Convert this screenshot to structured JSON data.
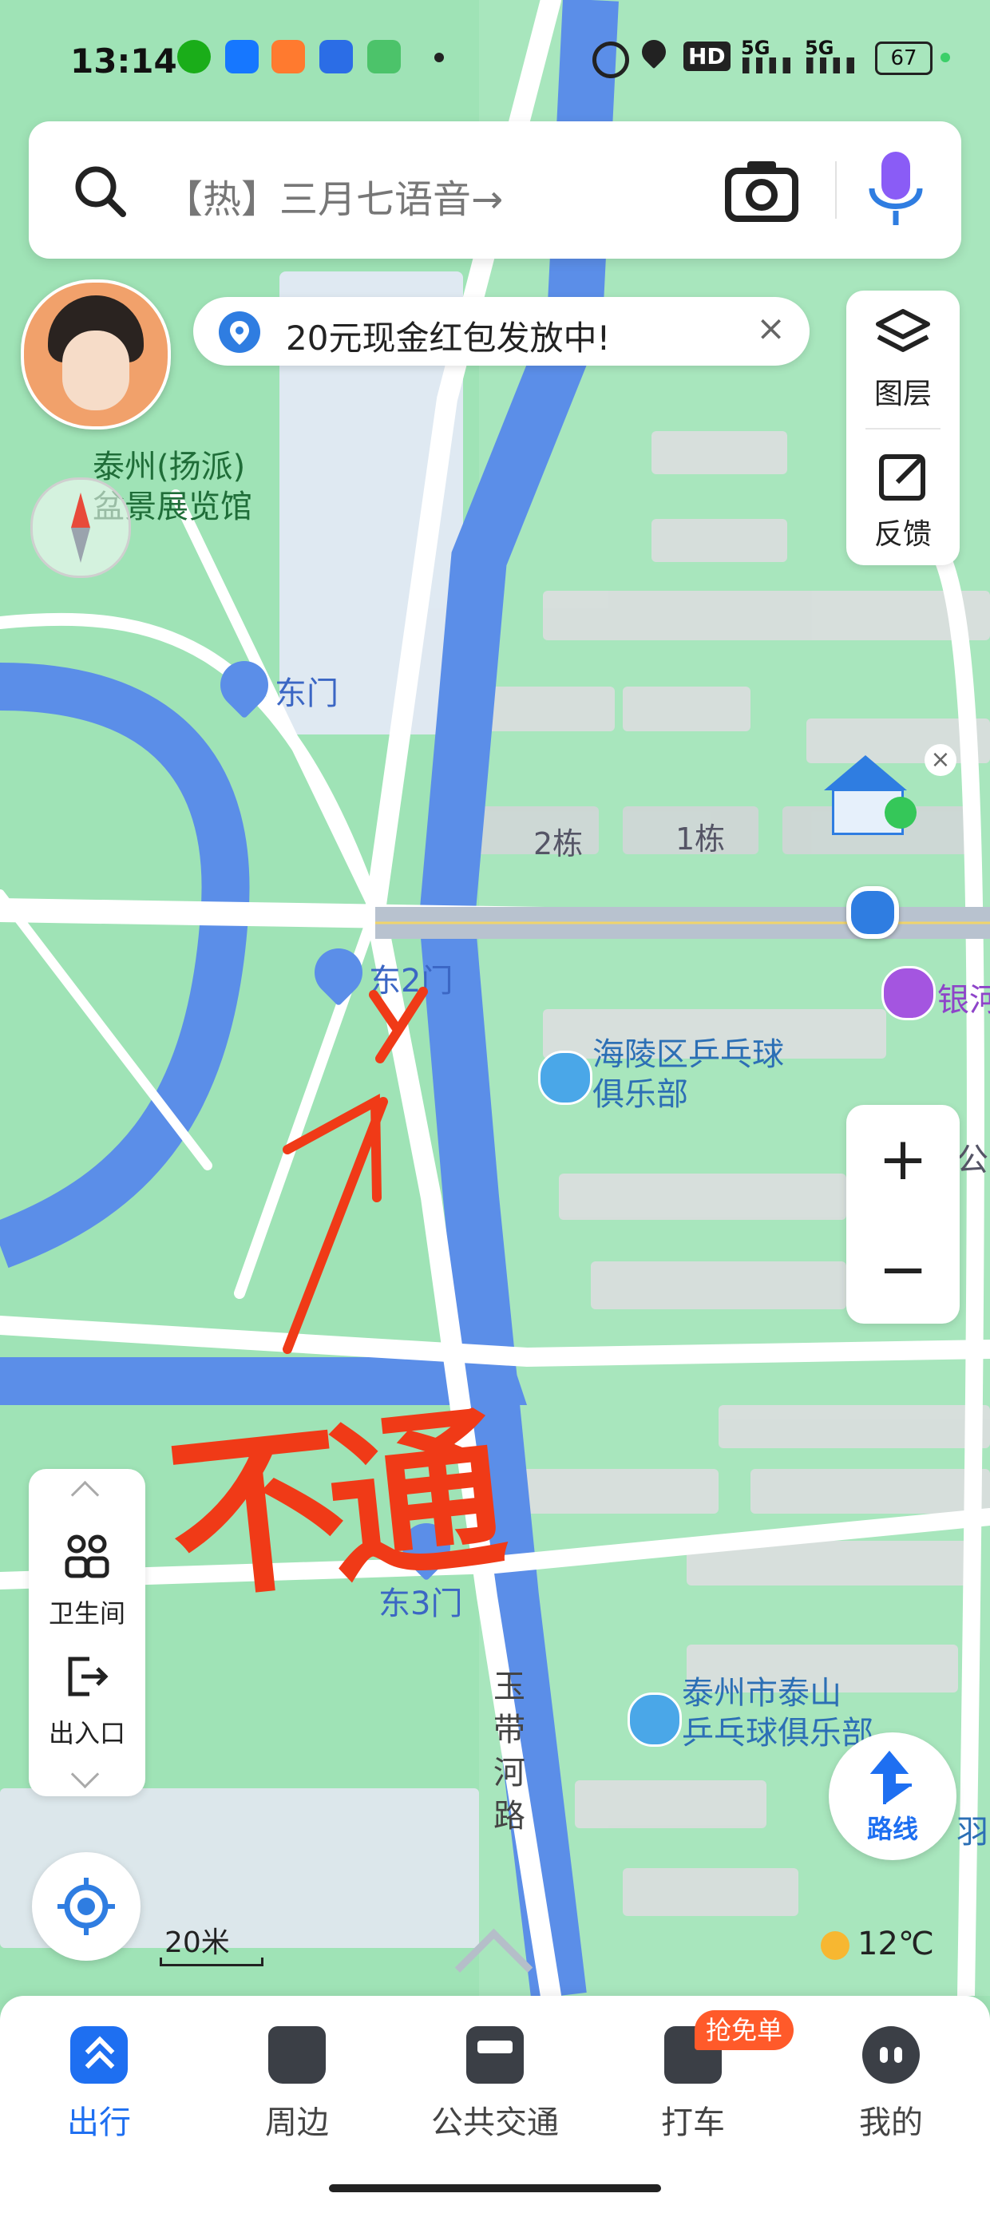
{
  "status_bar": {
    "time": "13:14",
    "network_5g_1": "5G",
    "network_5g_2": "5G",
    "hd": "HD",
    "battery": "67"
  },
  "search": {
    "placeholder": "【热】三月七语音→"
  },
  "promo": {
    "text": "20元现金红包发放中!",
    "close": "×"
  },
  "side_panel": {
    "layers_label": "图层",
    "feedback_label": "反馈"
  },
  "map": {
    "places": {
      "museum": "泰州(扬派)\n盆景展览馆",
      "east_gate": "东门",
      "east_gate_2": "东2门",
      "east_gate_3": "东3门",
      "pingpong_club_1_line1": "海陵区乒乓球",
      "pingpong_club_1_line2": "俱乐部",
      "pingpong_club_2_line1": "泰州市泰山",
      "pingpong_club_2_line2": "乒乓球俱乐部",
      "building_2": "2栋",
      "building_1": "1栋",
      "bank_partial": "银河",
      "road_name": "玉带河路",
      "partial_right_1": "公",
      "partial_right_2": "羽"
    },
    "annotation": {
      "text": "不通",
      "mark": "X"
    },
    "scale": "20米",
    "weather_temp": "12℃"
  },
  "left_panel": {
    "toilet_label": "卫生间",
    "entrance_label": "出入口"
  },
  "zoom": {
    "plus": "+",
    "minus": "−"
  },
  "route_button": {
    "label": "路线"
  },
  "tab_bar": {
    "tabs": [
      {
        "label": "出行",
        "active": true
      },
      {
        "label": "周边",
        "active": false
      },
      {
        "label": "公共交通",
        "active": false
      },
      {
        "label": "打车",
        "active": false
      },
      {
        "label": "我的",
        "active": false
      }
    ],
    "badge": "抢免单"
  },
  "colors": {
    "accent": "#1e6ff1",
    "park_green": "#9fe3b6",
    "water": "#5b8ee8",
    "annotation_red": "#f03a17"
  }
}
